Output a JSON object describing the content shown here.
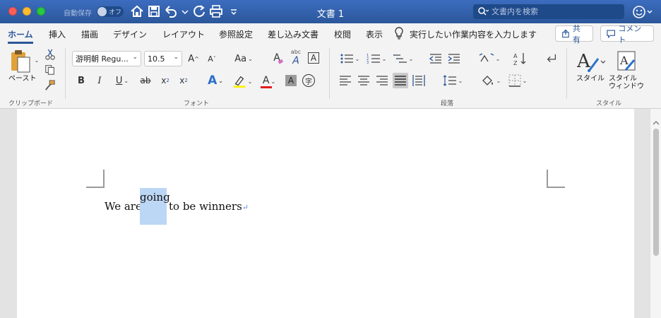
{
  "titlebar": {
    "autosave_label": "自動保存",
    "autosave_state": "オフ",
    "title": "文書 1",
    "search_placeholder": "文書内を検索"
  },
  "tabs": [
    {
      "label": "ホーム",
      "active": true
    },
    {
      "label": "挿入"
    },
    {
      "label": "描画"
    },
    {
      "label": "デザイン"
    },
    {
      "label": "レイアウト"
    },
    {
      "label": "参照設定"
    },
    {
      "label": "差し込み文書"
    },
    {
      "label": "校閲"
    },
    {
      "label": "表示"
    }
  ],
  "tell_me": "実行したい作業内容を入力します",
  "share_label": "共有",
  "comment_label": "コメント",
  "ribbon": {
    "clipboard": {
      "paste_label": "ペースト",
      "group_label": "クリップボード"
    },
    "font": {
      "font_name": "游明朝 Regu...",
      "font_size": "10.5",
      "grow_label": "A",
      "shrink_label": "A",
      "case_label": "Aa",
      "clear_label": "A",
      "phonetic_label": "abc",
      "border_label": "A",
      "bold": "B",
      "italic": "I",
      "underline": "U",
      "strike": "ab",
      "subscript": "x",
      "subscript_mark": "2",
      "superscript": "x",
      "superscript_mark": "2",
      "effects_label": "A",
      "color_label": "A",
      "shade_label": "A",
      "enclose_label": "字",
      "group_label": "フォント"
    },
    "paragraph": {
      "group_label": "段落"
    },
    "styles": {
      "style_label": "スタイル",
      "style_window_line1": "スタイル",
      "style_window_line2": "ウィンドウ",
      "group_label": "スタイル"
    }
  },
  "document": {
    "text_before": "We are",
    "selected_word": "going",
    "text_after": "to be winners",
    "pilcrow": "↵"
  },
  "colors": {
    "accent": "#2b579a",
    "selection": "#bcd6f5",
    "highlight": "#fff200",
    "font_color": "#e11c1c"
  }
}
